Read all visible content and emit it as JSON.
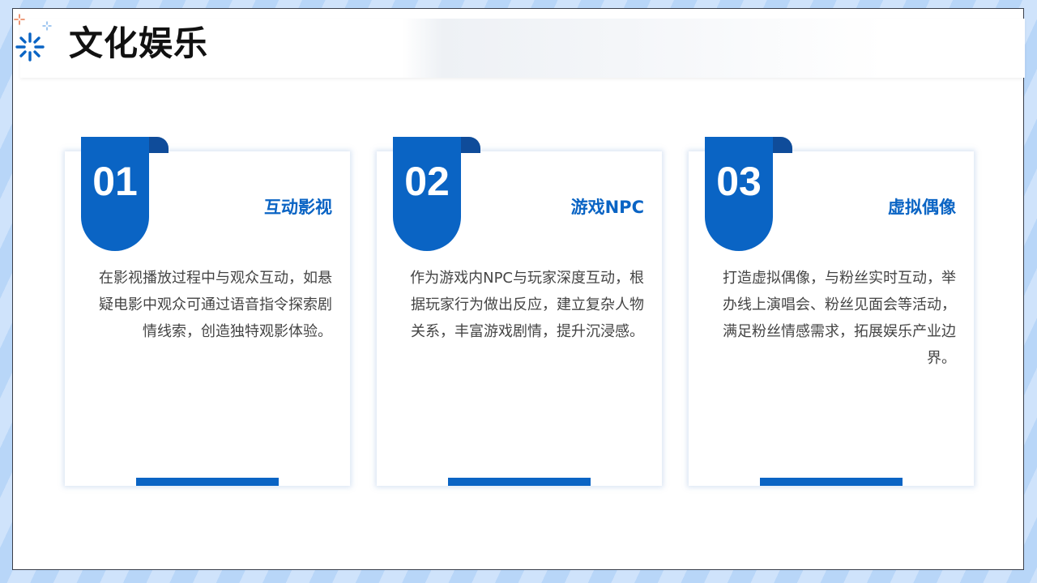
{
  "title": "文化娱乐",
  "colors": {
    "accent": "#0a64c4",
    "ribbon_fold": "#0f4c9a",
    "sparkle_orange": "#e97a4f"
  },
  "logo": {
    "icon": "sparkle-icon"
  },
  "cards": [
    {
      "number": "01",
      "title": "互动影视",
      "description": "在影视播放过程中与观众互动，如悬疑电影中观众可通过语音指令探索剧情线索，创造独特观影体验。"
    },
    {
      "number": "02",
      "title": "游戏NPC",
      "description": "作为游戏内NPC与玩家深度互动，根据玩家行为做出反应，建立复杂人物关系，丰富游戏剧情，提升沉浸感。"
    },
    {
      "number": "03",
      "title": "虚拟偶像",
      "description": "打造虚拟偶像，与粉丝实时互动，举办线上演唱会、粉丝见面会等活动，满足粉丝情感需求，拓展娱乐产业边界。"
    }
  ]
}
